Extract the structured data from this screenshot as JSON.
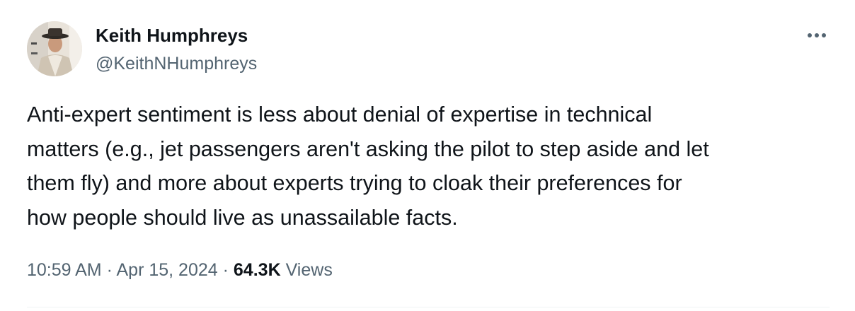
{
  "tweet": {
    "author": {
      "display_name": "Keith Humphreys",
      "handle": "@KeithNHumphreys",
      "avatar_icon": "avatar-photo"
    },
    "more_icon": "more-horizontal-icon",
    "text": "Anti-expert sentiment is less about denial of expertise in technical\nmatters (e.g., jet passengers aren't asking the pilot to step aside and let\nthem fly) and more about experts trying to cloak their preferences for\nhow people should live as unassailable facts.",
    "time": "10:59 AM",
    "separator": "·",
    "date": "Apr 15, 2024",
    "views_count": "64.3K",
    "views_label": "Views"
  },
  "colors": {
    "primary_text": "#0f1419",
    "secondary_text": "#536471",
    "divider": "#eff3f4"
  }
}
